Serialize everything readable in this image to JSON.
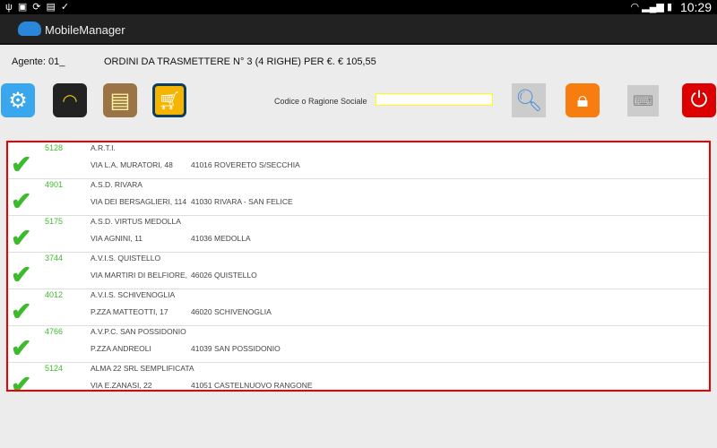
{
  "status": {
    "time": "10:29"
  },
  "app": {
    "title": "MobileManager"
  },
  "header": {
    "agent": "Agente: 01_",
    "orders": "ORDINI DA TRASMETTERE N° 3 (4 RIGHE) PER €. € 105,55"
  },
  "search": {
    "label": "Codice o Ragione Sociale",
    "value": ""
  },
  "rows": [
    {
      "code": "5128",
      "name": "A.R.T.I.",
      "address": "VIA L.A. MURATORI, 48",
      "city": "41016 ROVERETO S/SECCHIA"
    },
    {
      "code": "4901",
      "name": "A.S.D. RIVARA",
      "address": "VIA DEI BERSAGLIERI, 114",
      "city": "41030 RIVARA - SAN FELICE"
    },
    {
      "code": "5175",
      "name": "A.S.D. VIRTUS MEDOLLA",
      "address": "VIA AGNINI, 11",
      "city": "41036 MEDOLLA"
    },
    {
      "code": "3744",
      "name": "A.V.I.S. QUISTELLO",
      "address": "VIA MARTIRI DI BELFIORE,",
      "city": "46026 QUISTELLO"
    },
    {
      "code": "4012",
      "name": "A.V.I.S. SCHIVENOGLIA",
      "address": "P.ZZA MATTEOTTI, 17",
      "city": "46020 SCHIVENOGLIA"
    },
    {
      "code": "4766",
      "name": "A.V.P.C. SAN POSSIDONIO",
      "address": "P.ZZA ANDREOLI",
      "city": "41039 SAN POSSIDONIO"
    },
    {
      "code": "5124",
      "name": "ALMA 22 SRL SEMPLIFICATA",
      "address": "VIA E.ZANASI, 22",
      "city": "41051 CASTELNUOVO RANGONE"
    }
  ]
}
